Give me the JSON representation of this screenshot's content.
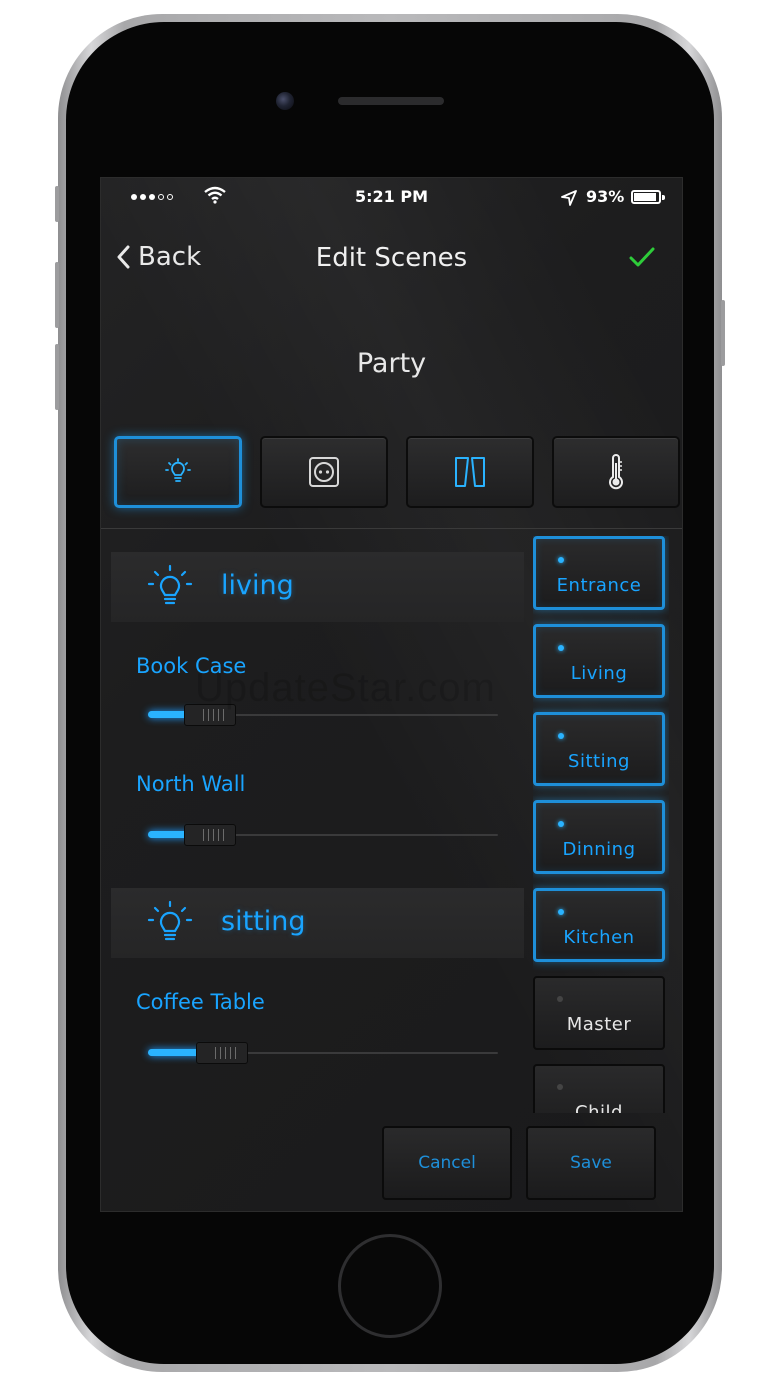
{
  "status_bar": {
    "time": "5:21 PM",
    "battery_percent": "93%",
    "battery_level": 0.93,
    "signal_bars": 3,
    "signal_total": 5
  },
  "nav": {
    "back_label": "Back",
    "title": "Edit Scenes",
    "confirm_icon": "checkmark-icon"
  },
  "scene": {
    "name": "Party"
  },
  "category_tabs": [
    {
      "icon": "lightbulb-icon",
      "active": true
    },
    {
      "icon": "outlet-icon",
      "active": false
    },
    {
      "icon": "blinds-icon",
      "active": false
    },
    {
      "icon": "thermometer-icon",
      "active": false
    }
  ],
  "groups": [
    {
      "label": "living",
      "devices": [
        {
          "label": "Book Case",
          "level": 0.12
        },
        {
          "label": "North Wall",
          "level": 0.12
        }
      ]
    },
    {
      "label": "sitting",
      "devices": [
        {
          "label": "Coffee Table",
          "level": 0.16
        }
      ]
    }
  ],
  "rooms": [
    {
      "label": "Entrance",
      "active": true
    },
    {
      "label": "Living",
      "active": true
    },
    {
      "label": "Sitting",
      "active": true
    },
    {
      "label": "Dinning",
      "active": true
    },
    {
      "label": "Kitchen",
      "active": true
    },
    {
      "label": "Master",
      "active": false
    },
    {
      "label": "Child",
      "active": false
    }
  ],
  "buttons": {
    "cancel": "Cancel",
    "save": "Save"
  },
  "watermark": "UpdateStar.com",
  "colors": {
    "accent": "#1e8fd9",
    "accent_text": "#19a4ff",
    "confirm": "#2ecc3a"
  }
}
